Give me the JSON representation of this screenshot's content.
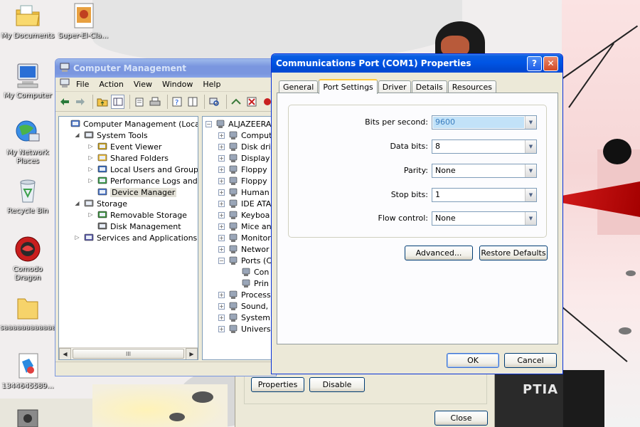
{
  "desktop": {
    "icons": [
      {
        "label": "My Documents",
        "icon": "folder-documents-icon"
      },
      {
        "label": "Super-El-Cla...",
        "icon": "image-file-icon"
      },
      {
        "label": "My Computer",
        "icon": "computer-icon"
      },
      {
        "label": "My Network Places",
        "icon": "network-icon"
      },
      {
        "label": "Recycle Bin",
        "icon": "recycle-bin-icon"
      },
      {
        "label": "Comodo Dragon",
        "icon": "comodo-dragon-icon"
      },
      {
        "label": "saaaaaaaaaaaa",
        "icon": "folder-icon"
      },
      {
        "label": "1344645589...",
        "icon": "image-file-icon"
      }
    ],
    "wallpaper_text": "PTIA"
  },
  "computer_management": {
    "title": "Computer Management",
    "menu": [
      "File",
      "Action",
      "View",
      "Window",
      "Help"
    ],
    "toolbar_icons": [
      "back-arrow-icon",
      "forward-arrow-icon",
      "up-folder-icon",
      "show-hide-tree-icon",
      "properties-icon",
      "print-icon",
      "help-icon",
      "toggle-pane-icon",
      "scan-hardware-icon",
      "update-driver-icon",
      "uninstall-icon",
      "disable-icon"
    ],
    "tree": [
      {
        "label": "Computer Management (Local)",
        "level": 0,
        "expander": "",
        "icon": "computer-management-icon"
      },
      {
        "label": "System Tools",
        "level": 1,
        "expander": "◢",
        "icon": "system-tools-icon"
      },
      {
        "label": "Event Viewer",
        "level": 2,
        "expander": "▷",
        "icon": "event-viewer-icon"
      },
      {
        "label": "Shared Folders",
        "level": 2,
        "expander": "▷",
        "icon": "shared-folders-icon"
      },
      {
        "label": "Local Users and Groups",
        "level": 2,
        "expander": "▷",
        "icon": "users-icon"
      },
      {
        "label": "Performance Logs and Alerts",
        "level": 2,
        "expander": "▷",
        "icon": "performance-icon"
      },
      {
        "label": "Device Manager",
        "level": 2,
        "expander": "",
        "icon": "device-manager-icon",
        "selected": true
      },
      {
        "label": "Storage",
        "level": 1,
        "expander": "◢",
        "icon": "storage-icon"
      },
      {
        "label": "Removable Storage",
        "level": 2,
        "expander": "▷",
        "icon": "removable-storage-icon"
      },
      {
        "label": "Disk Management",
        "level": 2,
        "expander": "",
        "icon": "disk-management-icon"
      },
      {
        "label": "Services and Applications",
        "level": 1,
        "expander": "▷",
        "icon": "services-icon"
      }
    ],
    "device_tree": [
      {
        "label": "ALJAZEERA",
        "level": 0,
        "expander": "−",
        "icon": "computer-icon"
      },
      {
        "label": "Comput",
        "level": 1,
        "expander": "+",
        "icon": "computer-icon"
      },
      {
        "label": "Disk driv",
        "level": 1,
        "expander": "+",
        "icon": "disk-drive-icon"
      },
      {
        "label": "Display",
        "level": 1,
        "expander": "+",
        "icon": "display-adapter-icon"
      },
      {
        "label": "Floppy",
        "level": 1,
        "expander": "+",
        "icon": "floppy-icon"
      },
      {
        "label": "Floppy",
        "level": 1,
        "expander": "+",
        "icon": "floppy-icon"
      },
      {
        "label": "Human",
        "level": 1,
        "expander": "+",
        "icon": "hid-icon"
      },
      {
        "label": "IDE ATA",
        "level": 1,
        "expander": "+",
        "icon": "ide-icon"
      },
      {
        "label": "Keyboa",
        "level": 1,
        "expander": "+",
        "icon": "keyboard-icon"
      },
      {
        "label": "Mice an",
        "level": 1,
        "expander": "+",
        "icon": "mouse-icon"
      },
      {
        "label": "Monitor",
        "level": 1,
        "expander": "+",
        "icon": "monitor-icon"
      },
      {
        "label": "Networ",
        "level": 1,
        "expander": "+",
        "icon": "network-adapter-icon"
      },
      {
        "label": "Ports (C",
        "level": 1,
        "expander": "−",
        "icon": "port-icon"
      },
      {
        "label": "Con",
        "level": 2,
        "expander": "",
        "icon": "port-icon"
      },
      {
        "label": "Prin",
        "level": 2,
        "expander": "",
        "icon": "port-icon"
      },
      {
        "label": "Process",
        "level": 1,
        "expander": "+",
        "icon": "processor-icon"
      },
      {
        "label": "Sound,",
        "level": 1,
        "expander": "+",
        "icon": "sound-icon"
      },
      {
        "label": "System",
        "level": 1,
        "expander": "+",
        "icon": "system-devices-icon"
      },
      {
        "label": "Univers",
        "level": 1,
        "expander": "+",
        "icon": "usb-icon"
      }
    ],
    "scroll_thumb": "III"
  },
  "device_manager_back": {
    "properties_label": "Properties",
    "disable_label": "Disable",
    "close_label": "Close"
  },
  "com_dialog": {
    "title": "Communications Port (COM1) Properties",
    "help_label": "?",
    "close_label": "✕",
    "tabs": [
      {
        "label": "General",
        "active": false
      },
      {
        "label": "Port Settings",
        "active": true
      },
      {
        "label": "Driver",
        "active": false
      },
      {
        "label": "Details",
        "active": false
      },
      {
        "label": "Resources",
        "active": false
      }
    ],
    "fields": [
      {
        "label": "Bits per second:",
        "value": "9600",
        "highlight": true
      },
      {
        "label": "Data bits:",
        "value": "8",
        "highlight": false
      },
      {
        "label": "Parity:",
        "value": "None",
        "highlight": false
      },
      {
        "label": "Stop bits:",
        "value": "1",
        "highlight": false
      },
      {
        "label": "Flow control:",
        "value": "None",
        "highlight": false
      }
    ],
    "advanced_label": "Advanced...",
    "restore_label": "Restore Defaults",
    "ok_label": "OK",
    "cancel_label": "Cancel"
  }
}
